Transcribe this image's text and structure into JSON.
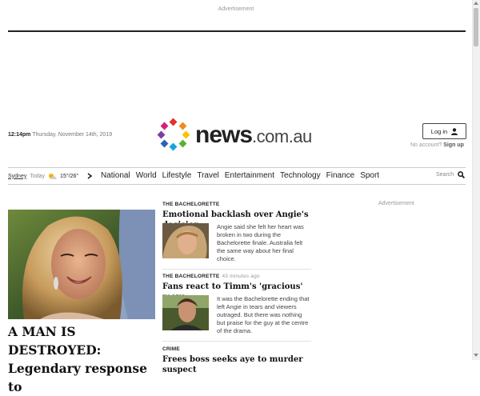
{
  "ad": {
    "top_label": "Advertisement",
    "right_label": "Advertisement"
  },
  "header": {
    "time": "12:14pm",
    "date": "Thursday, November 14th, 2019",
    "logo_main": "news",
    "logo_domain": ".com.au",
    "login_label": "Log in",
    "no_account": "No account?",
    "signup_label": "Sign up"
  },
  "weather": {
    "city": "Sydney",
    "today": "Today",
    "temps": "15°/26°",
    "icon": "partly-sunny-icon"
  },
  "nav": {
    "items": [
      "National",
      "World",
      "Lifestyle",
      "Travel",
      "Entertainment",
      "Technology",
      "Finance",
      "Sport"
    ],
    "search_label": "Search"
  },
  "hero": {
    "title": "A MAN IS DESTROYED: Legendary response to"
  },
  "stories": [
    {
      "kicker": "THE BACHELORETTE",
      "ago": "",
      "headline": "Emotional backlash over Angie's decision",
      "summary": "Angie said she felt her heart was broken in two during the Bachelorette finale. Australia felt the same way about her final choice."
    },
    {
      "kicker": "THE BACHELORETTE",
      "ago": "43 minutes ago",
      "headline": "Fans react to Timm's 'gracious' move",
      "summary": "It was the Bachelorette ending that left Angie in tears and viewers outraged. But there was nothing but praise for the guy at the centre of the drama."
    },
    {
      "kicker": "CRIME",
      "ago": "",
      "headline": "Frees boss seeks aye to murder suspect"
    }
  ],
  "colors": {
    "accent_dark": "#222222",
    "muted": "#999999"
  }
}
